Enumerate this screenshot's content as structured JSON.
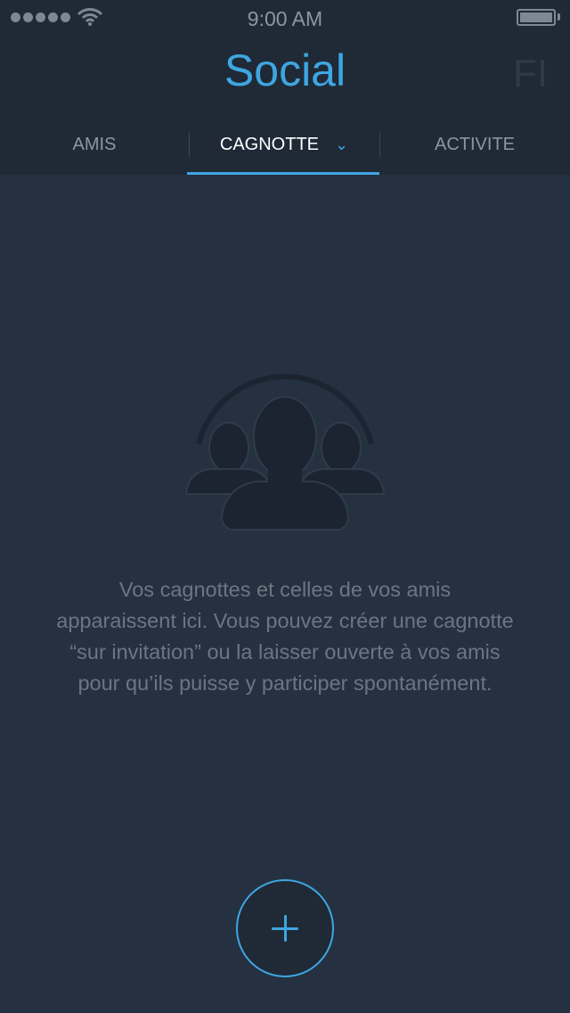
{
  "status_bar": {
    "time": "9:00 AM",
    "signal_icon": "signal-dots-icon",
    "wifi_icon": "wifi-icon",
    "battery_icon": "battery-icon"
  },
  "header": {
    "title": "Social",
    "next_title_peek": "FI"
  },
  "tabs": [
    {
      "label": "AMIS",
      "active": false
    },
    {
      "label": "CAGNOTTE",
      "active": true,
      "icon": "chevron-down-icon"
    },
    {
      "label": "ACTIVITE",
      "active": false
    }
  ],
  "empty_state": {
    "icon": "group-people-icon",
    "lines": [
      "Vos cagnottes et celles de vos amis",
      "apparaissent ici. Vous pouvez créer une cagnotte",
      "“sur invitation” ou la laisser ouverte à vos amis",
      "pour qu’ils puisse y participer spontanément."
    ]
  },
  "add_button": {
    "icon": "plus-icon"
  },
  "colors": {
    "accent": "#3ea6e2",
    "background": "#253140",
    "header": "#1f2a36",
    "muted_text": "#6b7682"
  }
}
